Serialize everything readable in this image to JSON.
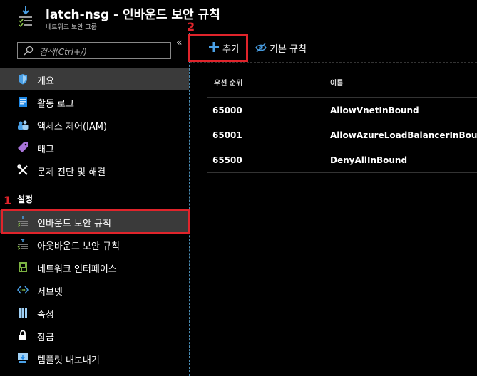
{
  "header": {
    "title": "latch-nsg - 인바운드 보안 규칙",
    "subtitle": "네트워크 보안 그룹"
  },
  "search": {
    "placeholder": "검색(Ctrl+/)"
  },
  "collapse_glyph": "«",
  "nav_top": [
    {
      "label": "개요",
      "icon": "shield-icon"
    },
    {
      "label": "활동 로그",
      "icon": "log-icon"
    },
    {
      "label": "액세스 제어(IAM)",
      "icon": "users-icon"
    },
    {
      "label": "태그",
      "icon": "tag-icon"
    },
    {
      "label": "문제 진단 및 해결",
      "icon": "wrench-icon"
    }
  ],
  "section": {
    "label": "설정"
  },
  "nav_settings": [
    {
      "label": "인바운드 보안 규칙",
      "icon": "inbound-rules-icon"
    },
    {
      "label": "아웃바운드 보안 규칙",
      "icon": "outbound-rules-icon"
    },
    {
      "label": "네트워크 인터페이스",
      "icon": "nic-icon"
    },
    {
      "label": "서브넷",
      "icon": "subnet-icon"
    },
    {
      "label": "속성",
      "icon": "properties-icon"
    },
    {
      "label": "잠금",
      "icon": "lock-icon"
    },
    {
      "label": "템플릿 내보내기",
      "icon": "export-icon"
    }
  ],
  "toolbar": {
    "add_label": "추가",
    "default_rules_label": "기본 규칙"
  },
  "table": {
    "headers": [
      "우선 순위",
      "이름"
    ],
    "rows": [
      {
        "priority": "65000",
        "name": "AllowVnetInBound"
      },
      {
        "priority": "65001",
        "name": "AllowAzureLoadBalancerInBound"
      },
      {
        "priority": "65500",
        "name": "DenyAllInBound"
      }
    ]
  },
  "annotations": {
    "step1": "1",
    "step2": "2",
    "color": "#e0242b"
  }
}
